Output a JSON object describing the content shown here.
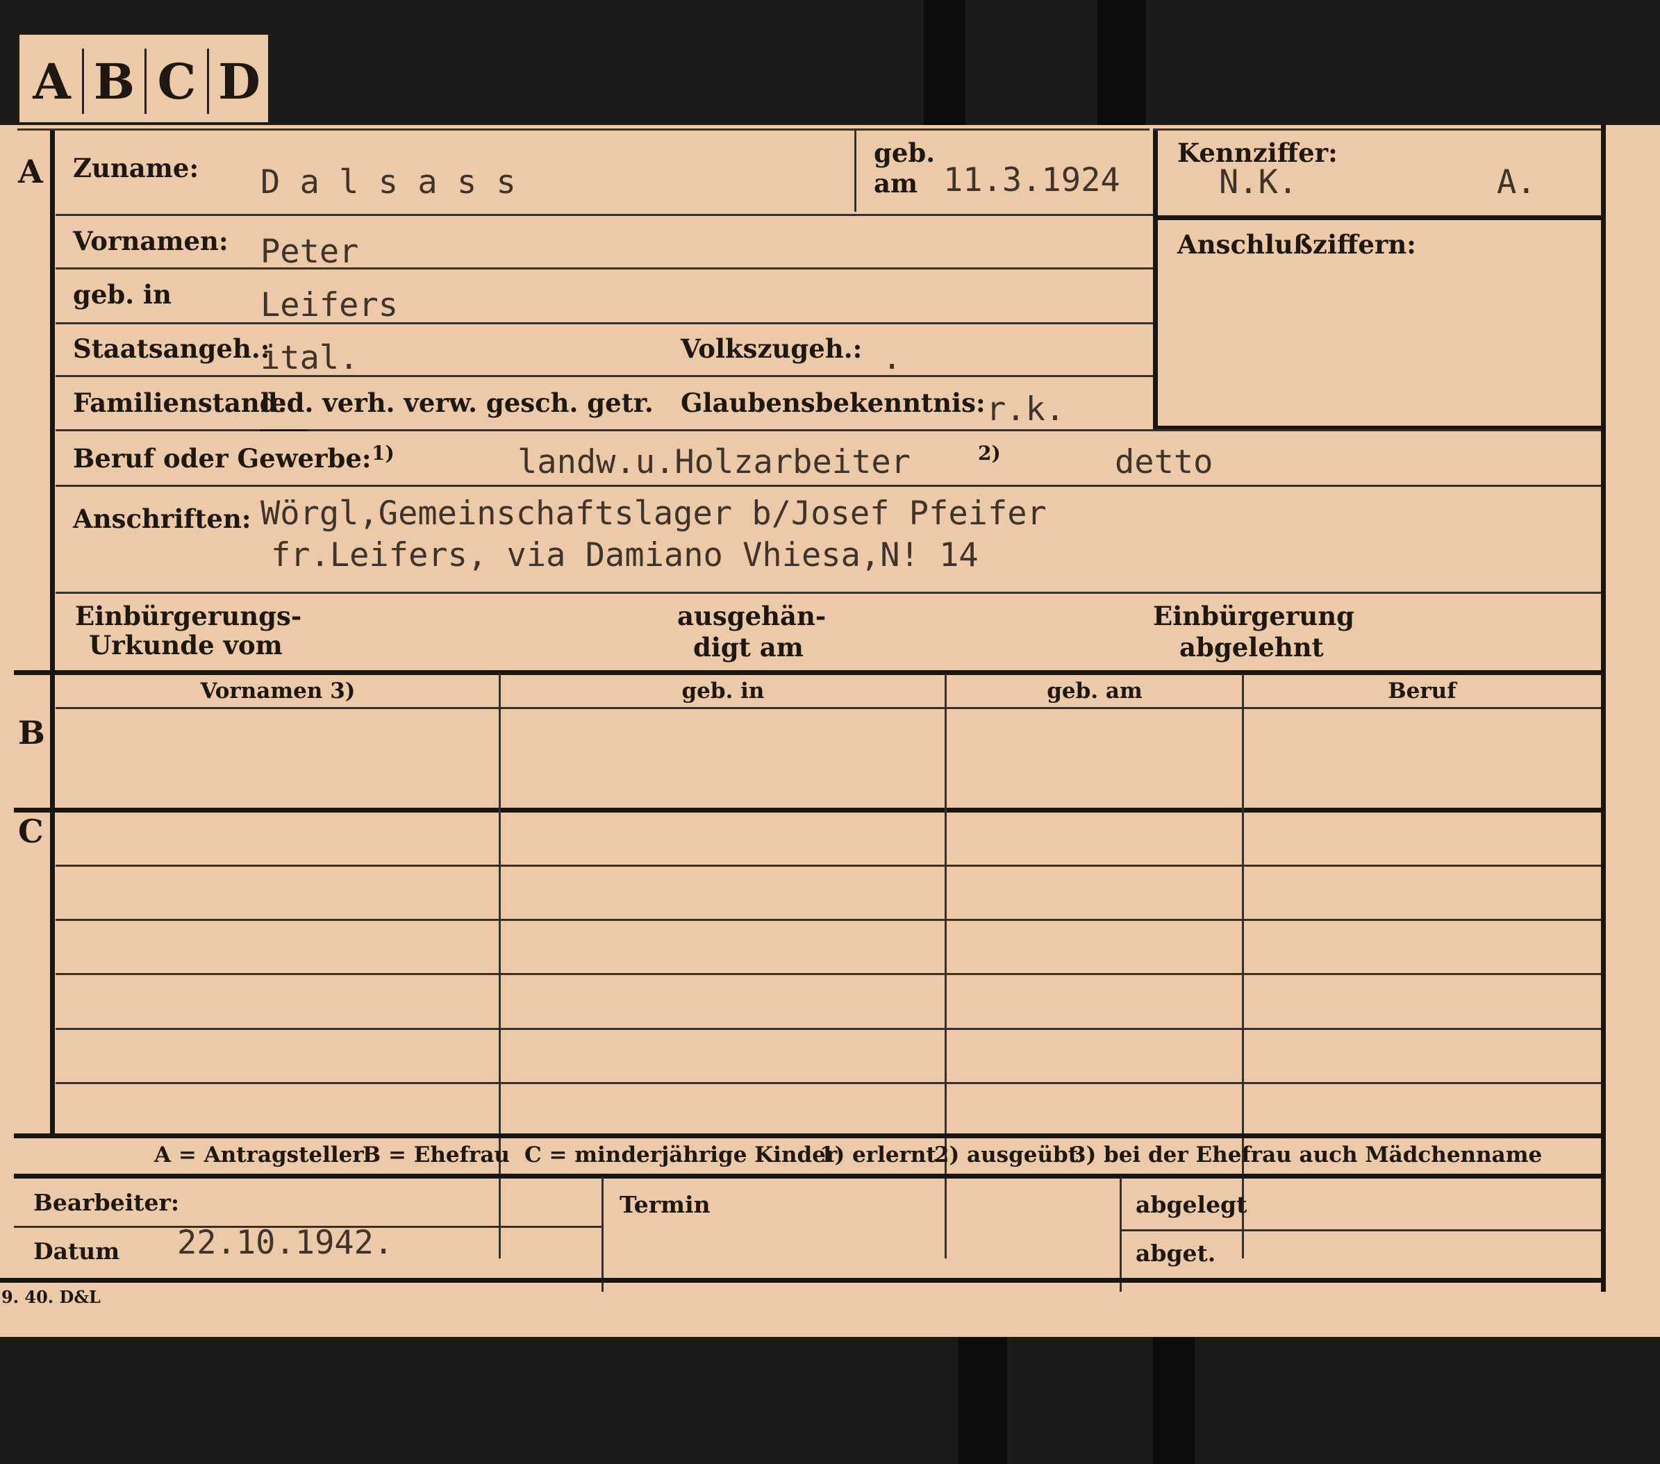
{
  "tabs": [
    "A",
    "B",
    "C",
    "D"
  ],
  "section_a": {
    "marker": "A",
    "zuname_label": "Zuname:",
    "zuname_value": "D a l s a s s",
    "geb_am_label_1": "geb.",
    "geb_am_label_2": "am",
    "geb_am_value": "11.3.1924",
    "kennziffer_label": "Kennziffer:",
    "kennziffer_value_1": "N.K.",
    "kennziffer_value_2": "A.",
    "anschluss_label": "Anschlußziffern:",
    "vornamen_label": "Vornamen:",
    "vornamen_value": "Peter",
    "geb_in_label": "geb. in",
    "geb_in_value": "Leifers",
    "staatsangeh_label": "Staatsangeh.:",
    "staatsangeh_value": "ital.",
    "volkszugeh_label": "Volkszugeh.:",
    "volkszugeh_value": ".",
    "familienstand_label": "Familienstand:",
    "familienstand_options": "led. verh. verw. gesch. getr.",
    "glauben_label": "Glaubensbekenntnis:",
    "glauben_value": "r.k.",
    "beruf_label": "Beruf oder Gewerbe:",
    "beruf_note_1": "1)",
    "beruf_value_1": "landw.u.Holzarbeiter",
    "beruf_note_2": "2)",
    "beruf_value_2": "detto",
    "anschriften_label": "Anschriften:",
    "anschrift_line_1": "Wörgl,Gemeinschaftslager b/Josef Pfeifer",
    "anschrift_line_2": "fr.Leifers, via Damiano Vhiesa,N! 14",
    "einb_urkunde_1": "Einbürgerungs-",
    "einb_urkunde_2": "Urkunde vom",
    "ausgehaendigt_1": "ausgehän-",
    "ausgehaendigt_2": "digt am",
    "einb_abgelehnt_1": "Einbürgerung",
    "einb_abgelehnt_2": "abgelehnt"
  },
  "section_b": {
    "marker": "B",
    "columns": [
      "Vornamen 3)",
      "geb. in",
      "geb. am",
      "Beruf"
    ]
  },
  "section_c": {
    "marker": "C"
  },
  "legend": {
    "a": "A = Antragsteller",
    "b": "B = Ehefrau",
    "c": "C = minderjährige Kinder",
    "n1": "1) erlernt",
    "n2": "2) ausgeübt",
    "n3": "3) bei der Ehefrau auch Mädchenname"
  },
  "footer": {
    "bearbeiter_label": "Bearbeiter:",
    "datum_label": "Datum",
    "datum_value": "22.10.1942.",
    "termin_label": "Termin",
    "abgelegt_label": "abgelegt",
    "abget_label": "abget."
  },
  "print_code": "9. 40. D&L",
  "colors": {
    "card": "#ecc9a9",
    "ink": "#1f1712",
    "typewriter": "#40332a",
    "background": "#1c1b1a"
  }
}
